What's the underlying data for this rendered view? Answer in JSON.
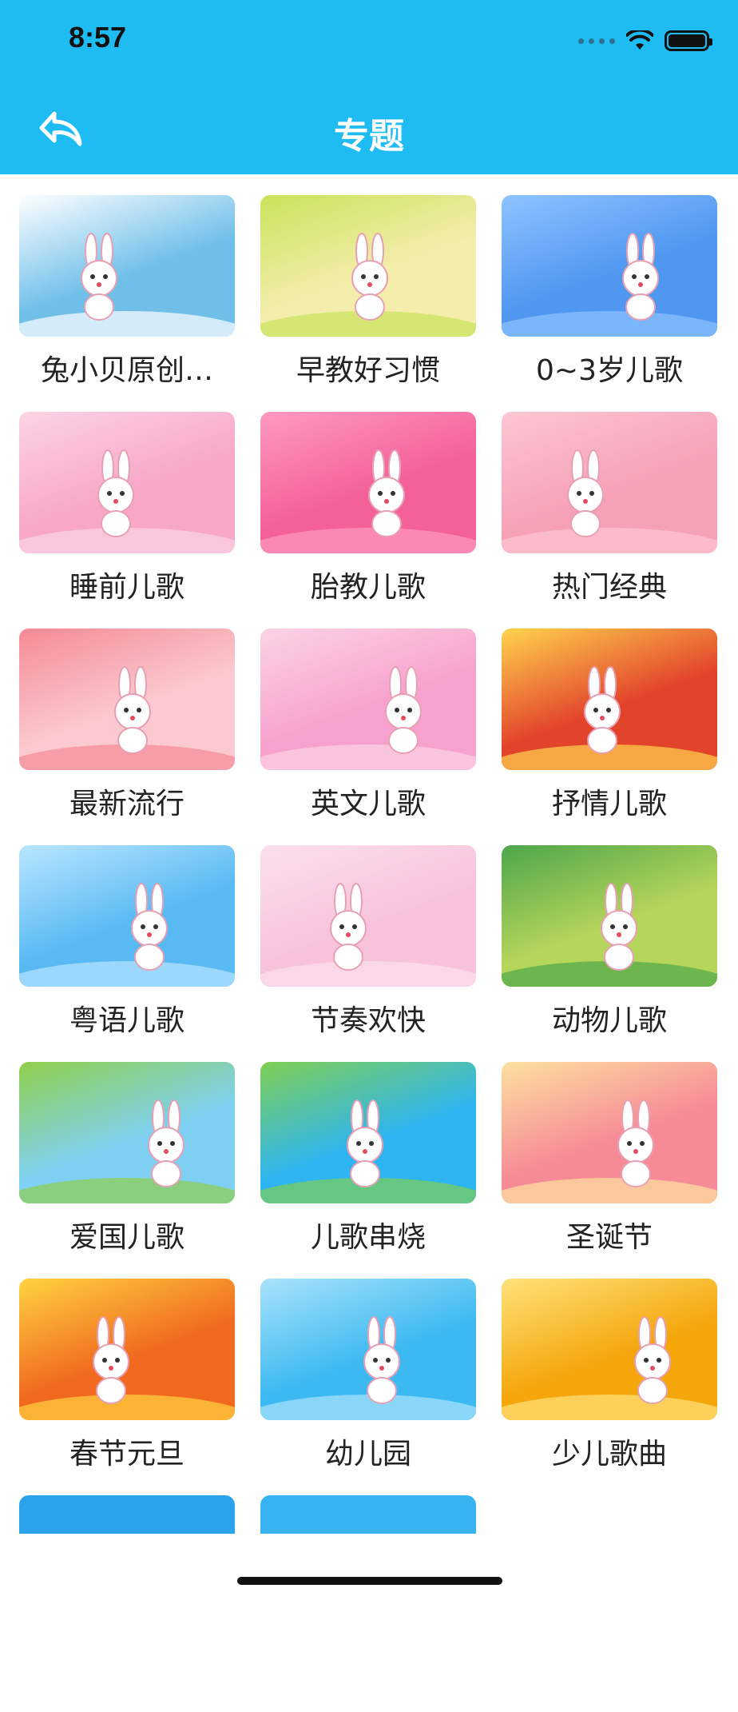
{
  "status_bar": {
    "time": "8:57"
  },
  "header": {
    "title": "专题"
  },
  "topics": [
    {
      "label": "兔小贝原创…",
      "bg": "#6fbfe9",
      "accent": "#ffffff"
    },
    {
      "label": "早教好习惯",
      "bg": "#f4edab",
      "accent": "#c9e35a"
    },
    {
      "label": "0~3岁儿歌",
      "bg": "#4f97f1",
      "accent": "#8fc3ff"
    },
    {
      "label": "睡前儿歌",
      "bg": "#f8a7c9",
      "accent": "#fbd3e3"
    },
    {
      "label": "胎教儿歌",
      "bg": "#f3609a",
      "accent": "#ff9ac0"
    },
    {
      "label": "热门经典",
      "bg": "#f7a1b7",
      "accent": "#fcc6d3"
    },
    {
      "label": "最新流行",
      "bg": "#fbc9cf",
      "accent": "#f58a95"
    },
    {
      "label": "英文儿歌",
      "bg": "#f7a2cc",
      "accent": "#fbd3e6"
    },
    {
      "label": "抒情儿歌",
      "bg": "#e2432b",
      "accent": "#ffd34d"
    },
    {
      "label": "粤语儿歌",
      "bg": "#58b9f3",
      "accent": "#b9e6ff"
    },
    {
      "label": "节奏欢快",
      "bg": "#f8c2dd",
      "accent": "#fbe0ee"
    },
    {
      "label": "动物儿歌",
      "bg": "#b6d55b",
      "accent": "#4da64a"
    },
    {
      "label": "爱国儿歌",
      "bg": "#7fd1f3",
      "accent": "#8fcf4a"
    },
    {
      "label": "儿歌串烧",
      "bg": "#2eb5f1",
      "accent": "#7fcf52"
    },
    {
      "label": "圣诞节",
      "bg": "#f68a96",
      "accent": "#fde1a0"
    },
    {
      "label": "春节元旦",
      "bg": "#f0691f",
      "accent": "#ffd340"
    },
    {
      "label": "幼儿园",
      "bg": "#3cb9f1",
      "accent": "#a9e3fb"
    },
    {
      "label": "少儿歌曲",
      "bg": "#f4a60b",
      "accent": "#ffe27a"
    },
    {
      "label": "",
      "bg": "#2aa3ec",
      "accent": "#2aa3ec"
    },
    {
      "label": "",
      "bg": "#38b3f2",
      "accent": "#38b3f2"
    }
  ]
}
